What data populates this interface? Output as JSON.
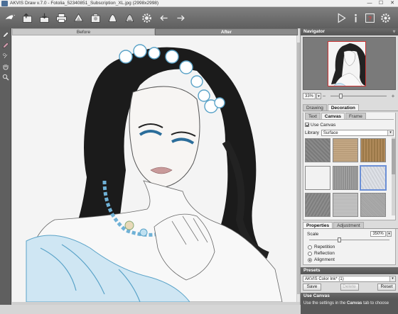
{
  "window": {
    "title": "AKVIS Draw v.7.0 - Fotolia_52340851_Subscription_XL.jpg (2998x2998)",
    "controls": [
      "—",
      "☐",
      "✕"
    ]
  },
  "toolbar": {
    "icons_left": [
      "logo-bird-icon",
      "open-file-icon",
      "save-file-icon",
      "print-icon",
      "share-icon",
      "batch-icon",
      "before-icon",
      "after-icon",
      "settings-icon",
      "undo-icon",
      "redo-icon"
    ],
    "icons_right": [
      "run-icon",
      "info-icon",
      "help-icon",
      "preferences-icon"
    ]
  },
  "left_tools": [
    "pencil-icon",
    "eraser-icon",
    "history-brush-icon",
    "hand-icon",
    "zoom-icon"
  ],
  "canvas": {
    "tab_before": "Before",
    "tab_after": "After"
  },
  "navigator": {
    "title": "Navigator",
    "zoom_value": "33%",
    "zoom_level": 0.33
  },
  "tabs": {
    "drawing": "Drawing",
    "decoration": "Decoration"
  },
  "subtabs": {
    "text": "Text",
    "canvas": "Canvas",
    "frame": "Frame"
  },
  "canvas_settings": {
    "use_canvas_label": "Use Canvas",
    "use_canvas_checked": true,
    "library_label": "Library",
    "library_value": "Surface",
    "selected_texture": 5
  },
  "textures": [
    "#8a8a8a",
    "#c9ad8a",
    "#b08a5a",
    "#bdb6aa",
    "#a8a8a8",
    "#d9dce2",
    "#8e8e8e",
    "#c0c0c0",
    "#aaaaaa"
  ],
  "properties": {
    "tab_properties": "Properties",
    "tab_adjustment": "Adjustment",
    "scale_label": "Scale",
    "scale_value": "350%",
    "options": [
      "Repetition",
      "Reflection",
      "Alignment"
    ],
    "selected_option": "Alignment"
  },
  "presets": {
    "title": "Presets",
    "value": "AKVIS Color Ink* (1)",
    "save": "Save",
    "delete": "Delete",
    "reset": "Reset"
  },
  "help": {
    "title": "Use Canvas",
    "text_before": "Use the settings in the ",
    "text_bold": "Canvas",
    "text_after": " tab to choose"
  },
  "colors": {
    "toolbar": "#6e6e6e",
    "accent_blue": "#6b8fd6",
    "panel_bg": "#dcdcdc"
  }
}
